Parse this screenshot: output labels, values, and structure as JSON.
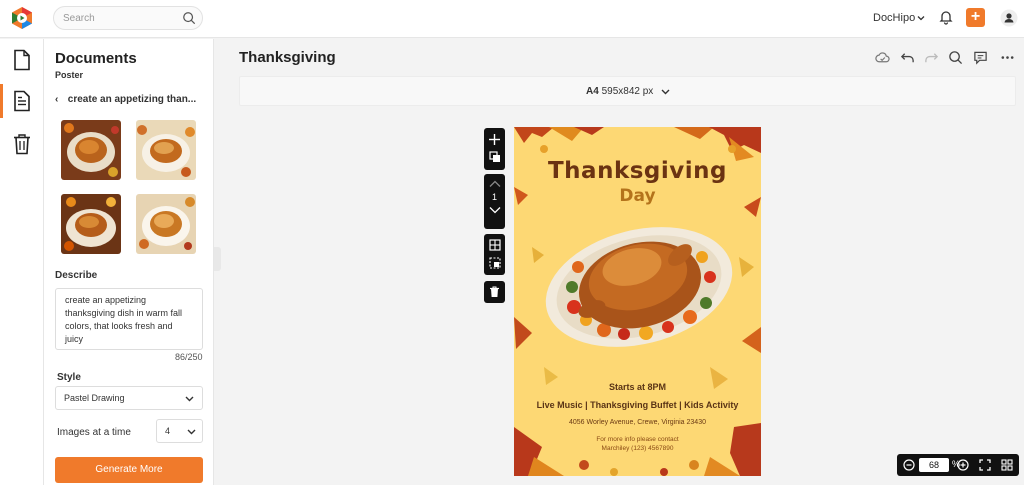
{
  "topbar": {
    "search_placeholder": "Search",
    "brand": "DocHipo"
  },
  "panel": {
    "title": "Documents",
    "subtitle": "Poster",
    "back_label": "create an appetizing than...",
    "describe_label": "Describe",
    "prompt_text": "create an appetizing thanksgiving dish in warm fall colors, that looks fresh and juicy",
    "counter": "86/250",
    "style_label": "Style",
    "style_value": "Pastel Drawing",
    "images_label": "Images at a time",
    "images_value": "4",
    "generate_label": "Generate More"
  },
  "editor": {
    "doc_title": "Thanksgiving",
    "size_name": "A4",
    "size_dims": "595x842 px",
    "page_number": "1",
    "zoom_value": "68",
    "zoom_unit": "%"
  },
  "poster": {
    "title": "Thanksgiving",
    "subtitle": "Day",
    "starts": "Starts at 8PM",
    "events": "Live Music | Thanksgiving Buffet | Kids Activity",
    "address": "4056 Worley Avenue, Crewe, Virginia 23430",
    "info_line1": "For more info please contact",
    "info_line2": "Marchiley (123) 4567890"
  },
  "colors": {
    "accent": "#f07a2b",
    "poster_bg": "#fdd874",
    "poster_title": "#6b3312"
  },
  "icons": [
    "app-logo-icon",
    "search-icon",
    "chevron-down-icon",
    "bell-icon",
    "plus-icon",
    "user-icon",
    "document-icon",
    "page-icon",
    "trash-icon",
    "cloud-icon",
    "undo-icon",
    "redo-icon",
    "comment-icon",
    "more-icon",
    "duplicate-icon",
    "chevron-up-icon",
    "grid-icon",
    "select-icon",
    "zoom-out-icon",
    "zoom-in-icon",
    "fullscreen-icon",
    "grid-view-icon"
  ]
}
